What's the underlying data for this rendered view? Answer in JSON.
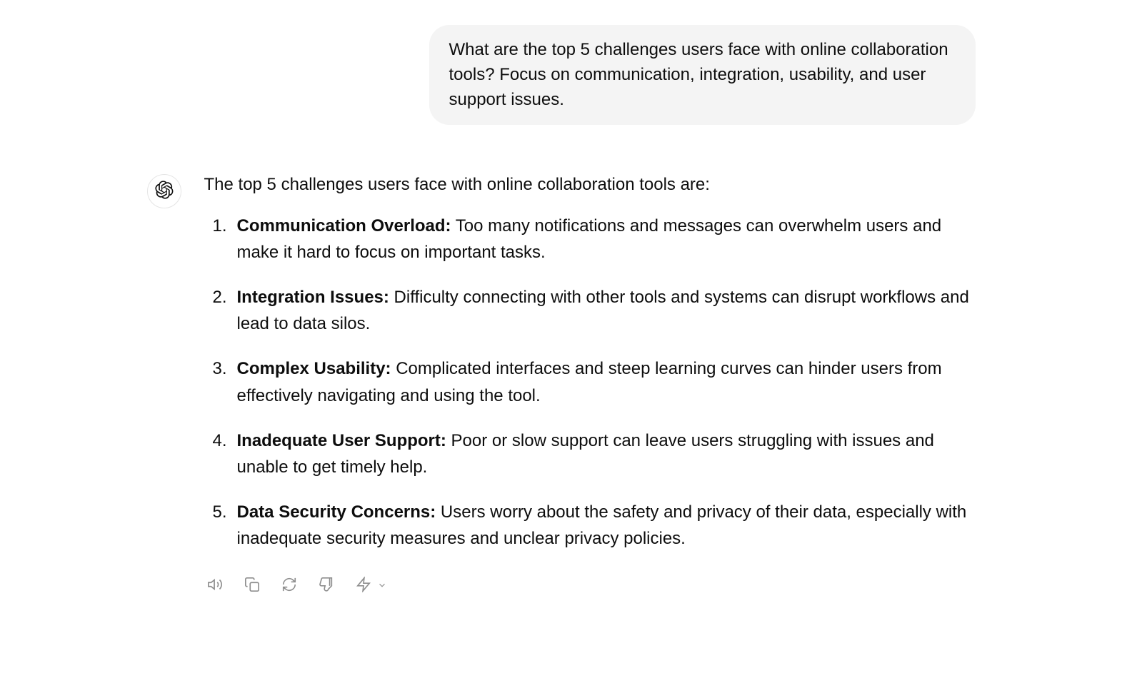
{
  "user_message": {
    "text": "What are the top 5 challenges users face with online collaboration tools? Focus on communication, integration, usability, and user support issues."
  },
  "assistant_message": {
    "intro": "The top 5 challenges users face with online collaboration tools are:",
    "items": [
      {
        "title": "Communication Overload:",
        "body": " Too many notifications and messages can overwhelm users and make it hard to focus on important tasks."
      },
      {
        "title": "Integration Issues:",
        "body": " Difficulty connecting with other tools and systems can disrupt workflows and lead to data silos."
      },
      {
        "title": "Complex Usability:",
        "body": " Complicated interfaces and steep learning curves can hinder users from effectively navigating and using the tool."
      },
      {
        "title": "Inadequate User Support:",
        "body": " Poor or slow support can leave users struggling with issues and unable to get timely help."
      },
      {
        "title": "Data Security Concerns:",
        "body": " Users worry about the safety and privacy of their data, especially with inadequate security measures and unclear privacy policies."
      }
    ]
  }
}
